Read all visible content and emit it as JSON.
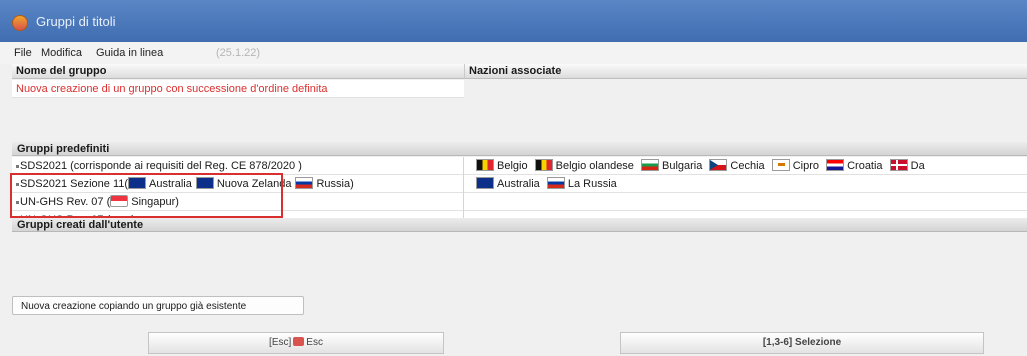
{
  "window": {
    "title": "Gruppi di titoli"
  },
  "menu": {
    "file": "File",
    "modifica": "Modifica",
    "guida": "Guida in linea",
    "version": "(25.1.22)"
  },
  "columns": {
    "name": "Nome del gruppo",
    "nations": "Nazioni associate"
  },
  "new_group_row": "Nuova creazione di un gruppo con successione d'ordine definita",
  "sections": {
    "predefined": "Gruppi predefiniti",
    "user": "Gruppi creati dall'utente"
  },
  "predefined_rows": [
    {
      "name": "SDS2021 (corrisponde ai requisiti del Reg. CE 878/2020 )",
      "nations": [
        "Belgio",
        "Belgio olandese",
        "Bulgaria",
        "Cechia",
        "Cipro",
        "Croatia",
        "Da"
      ]
    },
    {
      "name_prefix": "SDS2021 Sezione 11(",
      "name_flags": [
        "Australia",
        "Nuova Zelanda",
        "Russia)"
      ],
      "nations": [
        "Australia",
        "La Russia"
      ]
    },
    {
      "name_prefix": "UN-GHS Rev. 07 (",
      "name_suffix": "Singapur)"
    },
    {
      "name_prefix": "UN-GHS Rev. 07 (",
      "badge": "7",
      "name_suffix": ")"
    }
  ],
  "buttons": {
    "copy": "Nuova creazione copiando un gruppo già esistente",
    "esc_prefix": "[Esc]",
    "esc_label": "Esc",
    "select": "[1,3-6] Selezione"
  },
  "colors": {
    "title_bar": "#4a79bd",
    "highlight_text": "#d9302f",
    "annotation_box": "#d9302f"
  }
}
